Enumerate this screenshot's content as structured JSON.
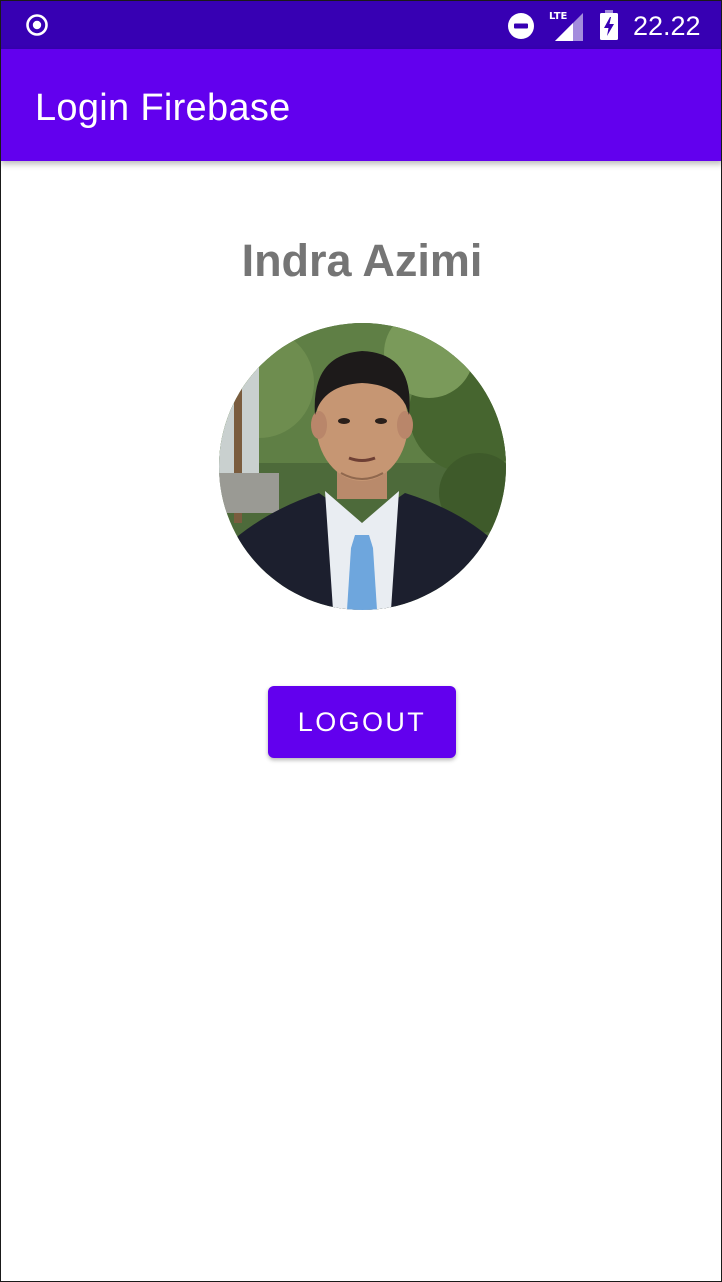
{
  "status_bar": {
    "time": "22.22",
    "network_label": "LTE",
    "icons": [
      "record-icon",
      "do-not-disturb-icon",
      "lte-signal-icon",
      "battery-charging-icon"
    ]
  },
  "app_bar": {
    "title": "Login Firebase"
  },
  "profile": {
    "name": "Indra Azimi",
    "avatar_icon": "profile-photo"
  },
  "actions": {
    "logout_label": "LOGOUT"
  },
  "colors": {
    "status_bar": "#3700b3",
    "primary": "#6200ee",
    "name_text": "#757575",
    "background": "#ffffff"
  }
}
